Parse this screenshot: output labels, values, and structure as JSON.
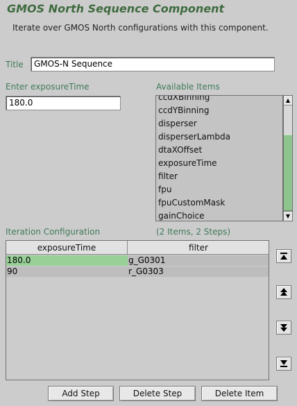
{
  "component": {
    "title": "GMOS North Sequence Component",
    "description": "Iterate over GMOS North configurations with this component."
  },
  "title_field": {
    "label": "Title",
    "value": "GMOS-N Sequence"
  },
  "exposure_field": {
    "label": "Enter exposureTime",
    "value": "180.0"
  },
  "available": {
    "label": "Available Items",
    "items": [
      "ccdXBinning",
      "ccdYBinning",
      "disperser",
      "disperserLambda",
      "dtaXOffset",
      "exposureTime",
      "filter",
      "fpu",
      "fpuCustomMask",
      "gainChoice"
    ]
  },
  "iteration": {
    "label": "Iteration Configuration",
    "count": "(2 Items, 2 Steps)",
    "columns": [
      "exposureTime",
      "filter"
    ],
    "rows": [
      [
        "180.0",
        "g_G0301"
      ],
      [
        "90",
        "r_G0303"
      ]
    ]
  },
  "buttons": {
    "add_step": "Add Step",
    "delete_step": "Delete Step",
    "delete_item": "Delete Item"
  },
  "side_buttons": [
    "move-top-icon",
    "move-up-icon",
    "move-down-icon",
    "move-bottom-icon"
  ],
  "colors": {
    "title": "#3f6b3f",
    "label": "#3f7a5a",
    "selected_cell": "#98d098",
    "scroll_thumb": "#8fc48f"
  }
}
